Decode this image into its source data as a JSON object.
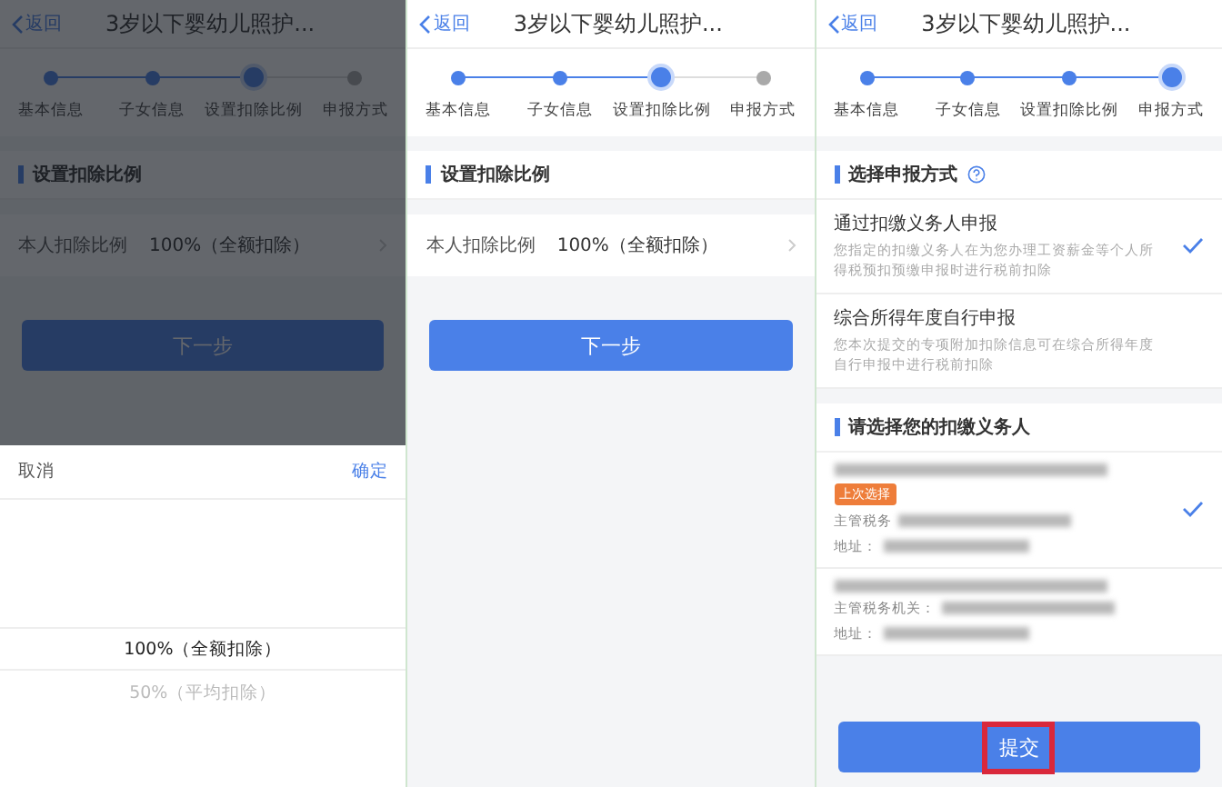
{
  "screens": [
    {
      "kind": "ratio",
      "dimmed": true,
      "nav": {
        "back": "返回",
        "title": "3岁以下婴幼儿照护..."
      },
      "steps": [
        {
          "label": "基本信息",
          "done": true,
          "selected": false
        },
        {
          "label": "子女信息",
          "done": true,
          "selected": false
        },
        {
          "label": "设置扣除比例",
          "done": true,
          "selected": true
        },
        {
          "label": "申报方式",
          "done": false,
          "selected": false
        }
      ],
      "section": "设置扣除比例",
      "row": {
        "label": "本人扣除比例",
        "value": "100%（全额扣除）"
      },
      "button": {
        "label": "下一步",
        "highlighted": false
      },
      "picker": {
        "cancel": "取消",
        "confirm": "确定",
        "options": [
          {
            "label": "100%（全额扣除）",
            "selected": true
          },
          {
            "label": "50%（平均扣除）",
            "selected": false
          }
        ]
      }
    },
    {
      "kind": "ratio",
      "nav": {
        "back": "返回",
        "title": "3岁以下婴幼儿照护..."
      },
      "steps": [
        {
          "label": "基本信息",
          "done": true,
          "selected": false
        },
        {
          "label": "子女信息",
          "done": true,
          "selected": false
        },
        {
          "label": "设置扣除比例",
          "done": true,
          "selected": true
        },
        {
          "label": "申报方式",
          "done": false,
          "selected": false
        }
      ],
      "section": "设置扣除比例",
      "row": {
        "label": "本人扣除比例",
        "value": "100%（全额扣除）"
      },
      "button": {
        "label": "下一步",
        "highlighted": false
      }
    },
    {
      "kind": "method",
      "nav": {
        "back": "返回",
        "title": "3岁以下婴幼儿照护..."
      },
      "steps": [
        {
          "label": "基本信息",
          "done": true,
          "selected": false
        },
        {
          "label": "子女信息",
          "done": true,
          "selected": false
        },
        {
          "label": "设置扣除比例",
          "done": true,
          "selected": false
        },
        {
          "label": "申报方式",
          "done": true,
          "selected": true
        }
      ],
      "section": "选择申报方式",
      "options": [
        {
          "title": "通过扣缴义务人申报",
          "desc": "您指定的扣缴义务人在为您办理工资薪金等个人所得税预扣预缴申报时进行税前扣除",
          "checked": true
        },
        {
          "title": "综合所得年度自行申报",
          "desc": "您本次提交的专项附加扣除信息可在综合所得年度自行申报中进行税前扣除",
          "checked": false
        }
      ],
      "section2": "请选择您的扣缴义务人",
      "employers": [
        {
          "tag": "上次选择",
          "fields": [
            "主管税务",
            "地址："
          ],
          "checked": true
        },
        {
          "fields": [
            "主管税务机关：",
            "地址："
          ],
          "checked": false
        }
      ],
      "button": {
        "label": "提交",
        "highlighted": true
      }
    }
  ]
}
